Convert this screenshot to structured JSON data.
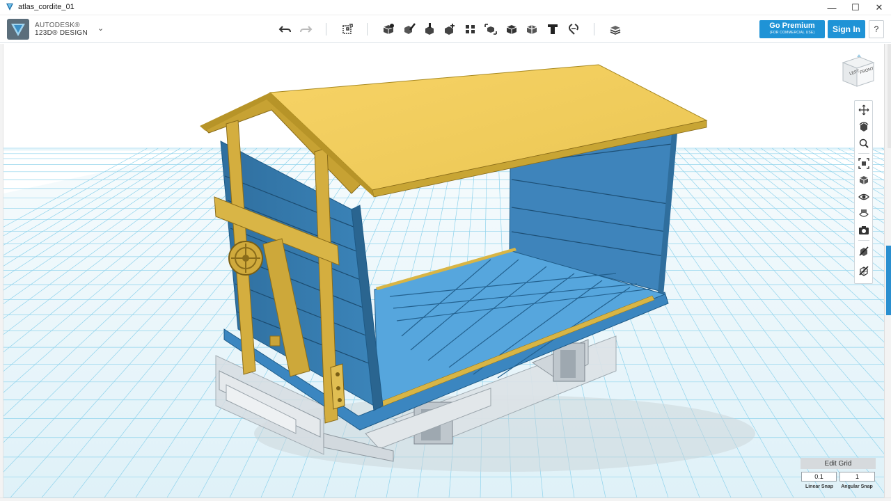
{
  "window": {
    "title": "atlas_cordite_01",
    "minimize_glyph": "—",
    "maximize_glyph": "☐",
    "close_glyph": "✕"
  },
  "brand": {
    "line1": "AUTODESK®",
    "line2": "123D® DESIGN",
    "menu_caret": "⌄"
  },
  "toolbar": {
    "icons": [
      "undo-icon",
      "redo-icon",
      "transform-icon",
      "primitives-icon",
      "sketch-icon",
      "construct-icon",
      "modify-icon",
      "pattern-icon",
      "group-icon",
      "combine-icon",
      "measure-icon",
      "text-icon",
      "snap-icon",
      "material-icon"
    ]
  },
  "premium": {
    "label": "Go Premium",
    "sublabel": "(FOR COMMERCIAL USE)"
  },
  "signin": {
    "label": "Sign In"
  },
  "help": {
    "label": "?"
  },
  "viewcube": {
    "left_face": "LEFT",
    "front_face": "FRONT"
  },
  "navbar": {
    "icons": [
      "pan-icon",
      "orbit-icon",
      "zoom-icon",
      "fit-icon",
      "view-icon",
      "visibility-icon",
      "materials-outlines-icon",
      "camera-icon",
      "hide-sketch-icon",
      "hide-mesh-icon"
    ]
  },
  "grid": {
    "header": "Edit Grid",
    "linear_snap_value": "0.1",
    "angular_snap_value": "1",
    "linear_snap_label": "Linear Snap",
    "angular_snap_label": "Angular Snap"
  },
  "colors": {
    "accent": "#1f93d6",
    "grid_line": "#8fd3ec",
    "body_blue": "#3c82b9",
    "floor_blue": "#5aa6db",
    "roof_yellow": "#f2cd5c",
    "frame_gold": "#c9a234"
  }
}
